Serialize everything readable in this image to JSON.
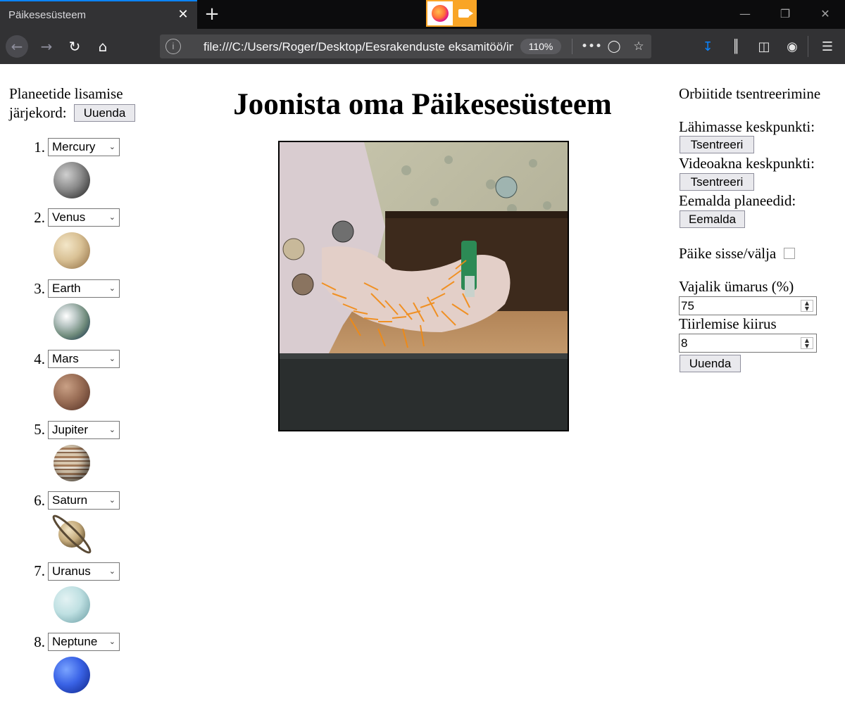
{
  "browser": {
    "tab_title": "Päikesesüsteem",
    "tab_close": "✕",
    "new_tab": "+",
    "url": "file:///C:/Users/Roger/Desktop/Eesrakenduste eksamitöö/index.html",
    "zoom": "110%",
    "icons": [
      "back-icon",
      "forward-icon",
      "reload-icon",
      "home-icon",
      "info-icon",
      "more-icon",
      "pocket-icon",
      "star-icon",
      "download-icon",
      "library-icon",
      "sidebar-icon",
      "account-icon",
      "menu-icon"
    ]
  },
  "left_panel": {
    "title_line1": "Planeetide lisamise",
    "title_line2": "järjekord:",
    "update_button": "Uuenda",
    "planets": [
      {
        "num": "1.",
        "name": "Mercury"
      },
      {
        "num": "2.",
        "name": "Venus"
      },
      {
        "num": "3.",
        "name": "Earth"
      },
      {
        "num": "4.",
        "name": "Mars"
      },
      {
        "num": "5.",
        "name": "Jupiter"
      },
      {
        "num": "6.",
        "name": "Saturn"
      },
      {
        "num": "7.",
        "name": "Uranus"
      },
      {
        "num": "8.",
        "name": "Neptune"
      }
    ]
  },
  "main": {
    "title": "Joonista oma Päikesesüsteem"
  },
  "right_panel": {
    "heading": "Orbiitide tsentreerimine",
    "nearest_label": "Lähimasse keskpunkti:",
    "nearest_button": "Tsentreeri",
    "video_center_label": "Videoakna keskpunkti:",
    "video_center_button": "Tsentreeri",
    "remove_label": "Eemalda planeedid:",
    "remove_button": "Eemalda",
    "sun_toggle_label": "Päike sisse/välja",
    "sun_toggle_checked": false,
    "roundness_label": "Vajalik ümarus (%)",
    "roundness_value": "75",
    "speed_label": "Tiirlemise kiirus",
    "speed_value": "8",
    "update_button": "Uuenda"
  }
}
